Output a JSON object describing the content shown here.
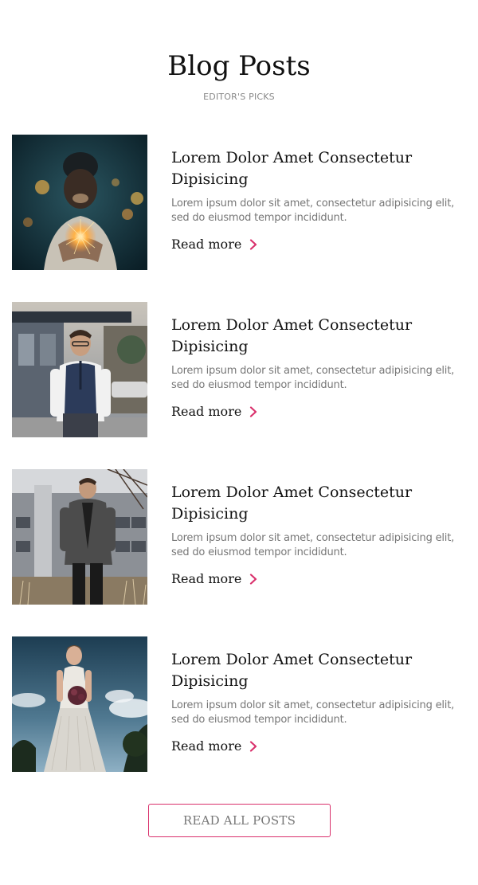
{
  "header": {
    "title": "Blog Posts",
    "subtitle": "EDITOR'S PICKS"
  },
  "posts": [
    {
      "title": "Lorem Dolor Amet Consectetur Dipisicing",
      "excerpt": "Lorem ipsum dolor sit amet, consectetur adipisicing elit, sed do eiusmod tempor incididunt.",
      "read_more": "Read more",
      "image": "man-holding-sparkler-photo"
    },
    {
      "title": "Lorem Dolor Amet Consectetur Dipisicing",
      "excerpt": "Lorem ipsum dolor sit amet, consectetur adipisicing elit, sed do eiusmod tempor incididunt.",
      "read_more": "Read more",
      "image": "man-in-vest-street-photo"
    },
    {
      "title": "Lorem Dolor Amet Consectetur Dipisicing",
      "excerpt": "Lorem ipsum dolor sit amet, consectetur adipisicing elit, sed do eiusmod tempor incididunt.",
      "read_more": "Read more",
      "image": "man-in-coat-building-photo"
    },
    {
      "title": "Lorem Dolor Amet Consectetur Dipisicing",
      "excerpt": "Lorem ipsum dolor sit amet, consectetur adipisicing elit, sed do eiusmod tempor incididunt.",
      "read_more": "Read more",
      "image": "bride-with-bouquet-photo"
    }
  ],
  "footer": {
    "read_all_label": "READ ALL POSTS"
  },
  "colors": {
    "accent": "#d9316c",
    "text": "#111111",
    "muted": "#777777",
    "subtitle": "#888888"
  },
  "icons": {
    "read_more": "chevron-right-icon"
  }
}
